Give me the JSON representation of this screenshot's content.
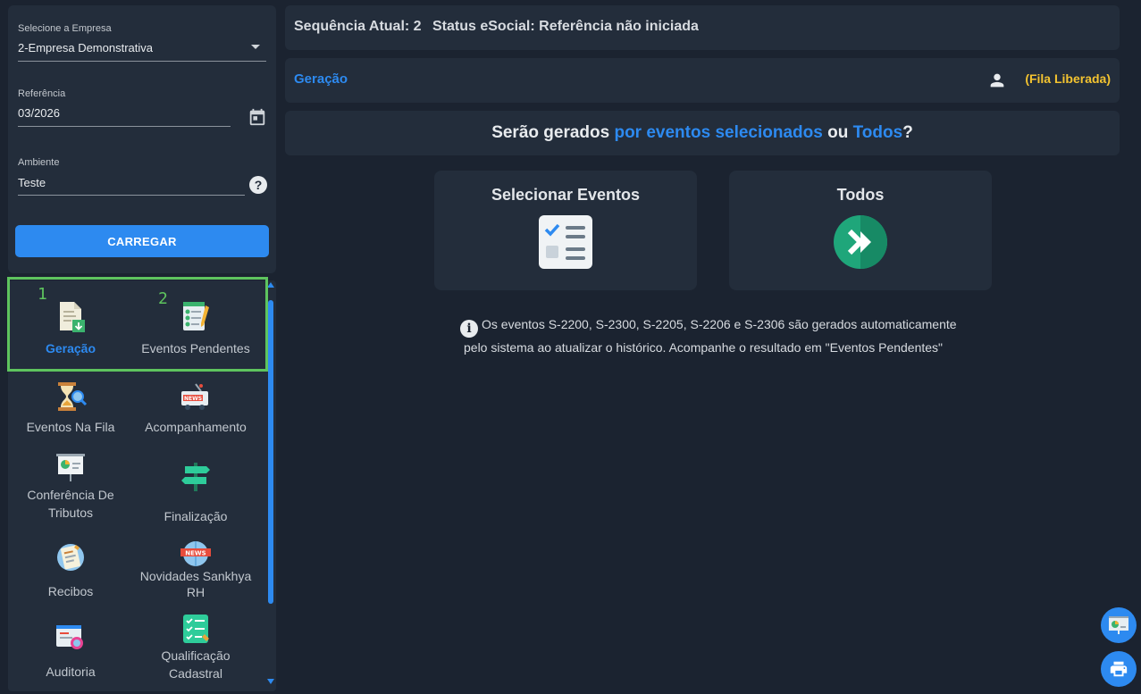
{
  "form": {
    "company_label": "Selecione a Empresa",
    "company_value": "2-Empresa Demonstrativa",
    "reference_label": "Referência",
    "reference_value": "03/2026",
    "environment_label": "Ambiente",
    "environment_value": "Teste",
    "help_glyph": "?",
    "load_button": "CARREGAR"
  },
  "nav": {
    "markers": [
      "1",
      "2"
    ],
    "items": [
      {
        "label": "Geração",
        "icon": "document-download-icon",
        "active": true
      },
      {
        "label": "Eventos Pendentes",
        "icon": "checklist-pencil-icon"
      },
      {
        "label": "Eventos Na Fila",
        "icon": "hourglass-search-icon"
      },
      {
        "label": "Acompanhamento",
        "icon": "news-truck-icon"
      },
      {
        "label": "Conferência De Tributos",
        "icon": "presentation-chart-icon"
      },
      {
        "label": "Finalização",
        "icon": "signpost-icon"
      },
      {
        "label": "Recibos",
        "icon": "receipt-icon"
      },
      {
        "label": "Novidades Sankhya RH",
        "icon": "news-globe-icon"
      },
      {
        "label": "Auditoria",
        "icon": "audit-search-icon"
      },
      {
        "label": "Qualificação Cadastral",
        "icon": "checklist-board-icon"
      }
    ]
  },
  "status": {
    "sequence": "Sequência Atual: 2",
    "esocial": "Status eSocial: Referência não iniciada"
  },
  "tab": {
    "title": "Geração",
    "queue_status": "(Fila Liberada)"
  },
  "question": {
    "part1": "Serão gerados ",
    "part2": "por eventos selecionados",
    "part3": " ou ",
    "part4": "Todos",
    "part5": "?"
  },
  "cards": {
    "select_events": "Selecionar Eventos",
    "all": "Todos"
  },
  "info": {
    "glyph": "i",
    "line1": "Os eventos S-2200, S-2300, S-2205, S-2206 e S-2306 são gerados automaticamente",
    "line2": "pelo sistema ao atualizar o histórico. Acompanhe o resultado em \"Eventos Pendentes\""
  },
  "colors": {
    "accent": "#2d8af0",
    "highlight": "#5ec45e",
    "queue": "#f3c330",
    "background": "#1b2330",
    "panel": "#232d3b"
  }
}
